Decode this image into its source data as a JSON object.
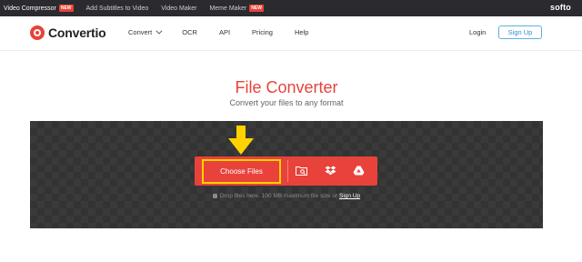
{
  "topbar": {
    "tools": [
      {
        "label": "Video Compressor",
        "badge": "NEW"
      },
      {
        "label": "Add Subtitles to Video",
        "badge": ""
      },
      {
        "label": "Video Maker",
        "badge": ""
      },
      {
        "label": "Meme Maker",
        "badge": "NEW"
      }
    ],
    "brand": "softo"
  },
  "nav": {
    "logo_text": "Convertio",
    "menu": [
      "Convert",
      "OCR",
      "API",
      "Pricing",
      "Help"
    ],
    "login": "Login",
    "signup": "Sign Up"
  },
  "hero": {
    "title": "File Converter",
    "subtitle": "Convert your files to any format"
  },
  "upload": {
    "choose_label": "Choose Files",
    "hint_text": "Drop files here. 100 MB maximum file size or",
    "hint_link": "Sign Up"
  },
  "icons": {
    "logo": "convertio-logo-icon",
    "folder": "folder-search-icon",
    "dropbox": "dropbox-icon",
    "drive": "google-drive-icon",
    "arrow": "arrow-down-icon",
    "lock": "lock-icon"
  },
  "colors": {
    "accent": "#e8423a",
    "highlight": "#ffd200",
    "topbar": "#2b2b2f",
    "dropzone": "#3a3a3a",
    "signup": "#2f8fd0"
  }
}
